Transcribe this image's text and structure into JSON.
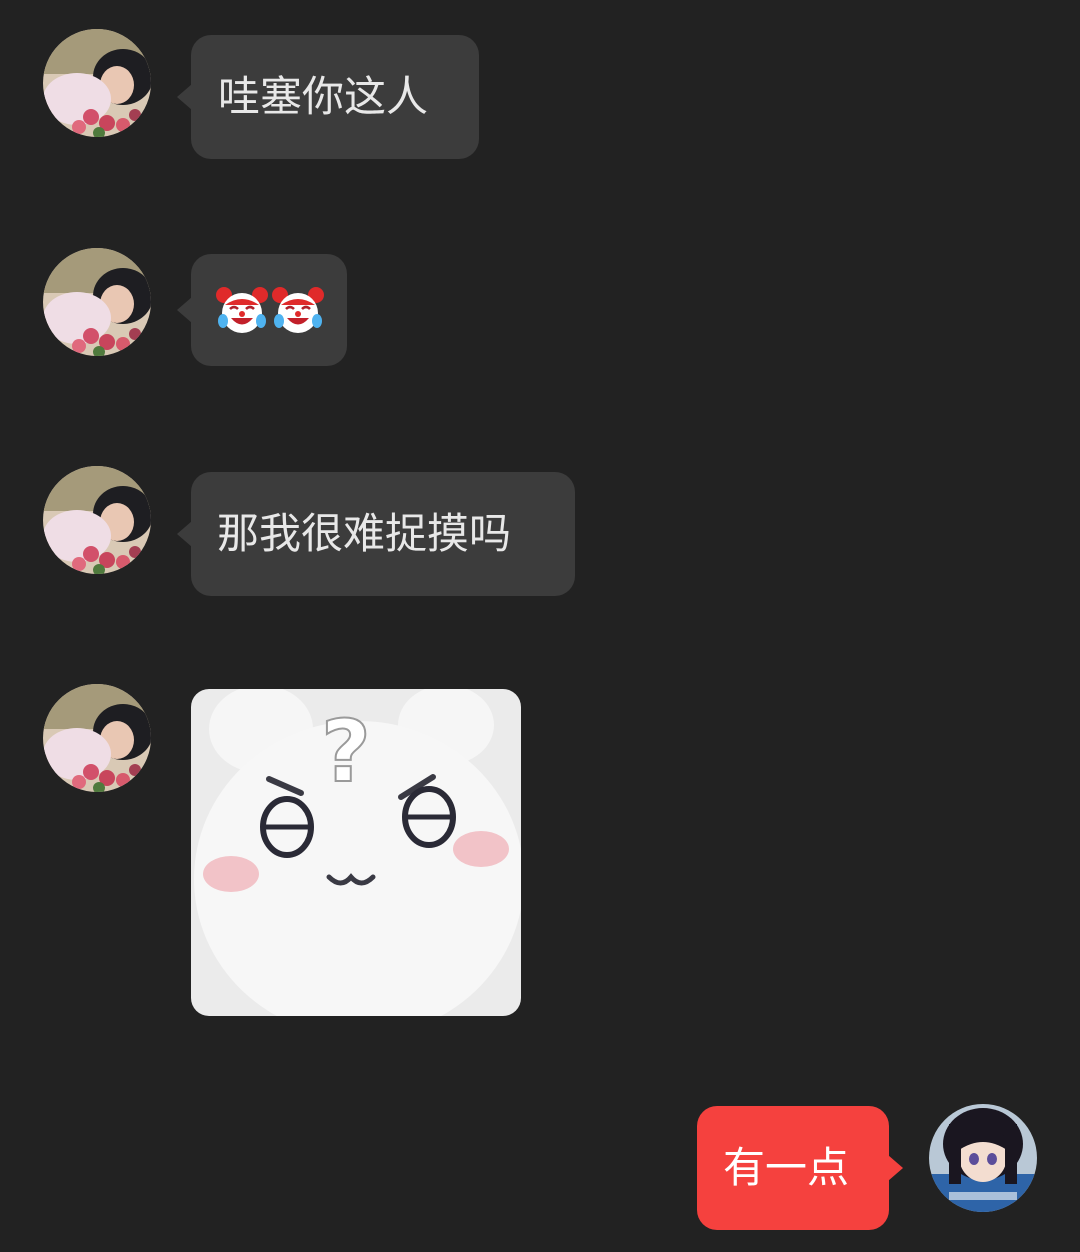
{
  "chat": {
    "messages": [
      {
        "sender": "contact",
        "type": "text",
        "text": "哇塞你这人"
      },
      {
        "sender": "contact",
        "type": "emoji",
        "emoji": [
          "clown-crying-laughing-emoji",
          "clown-crying-laughing-emoji"
        ]
      },
      {
        "sender": "contact",
        "type": "text",
        "text": "那我很难捉摸吗"
      },
      {
        "sender": "contact",
        "type": "sticker",
        "sticker": "white-plush-bear-question-sticker",
        "text": "?"
      },
      {
        "sender": "self",
        "type": "text",
        "text": "有一点"
      }
    ]
  },
  "colors": {
    "background": "#222222",
    "incoming_bubble": "#3c3c3c",
    "outgoing_bubble": "#f5413e",
    "text": "#e8e8e8"
  }
}
